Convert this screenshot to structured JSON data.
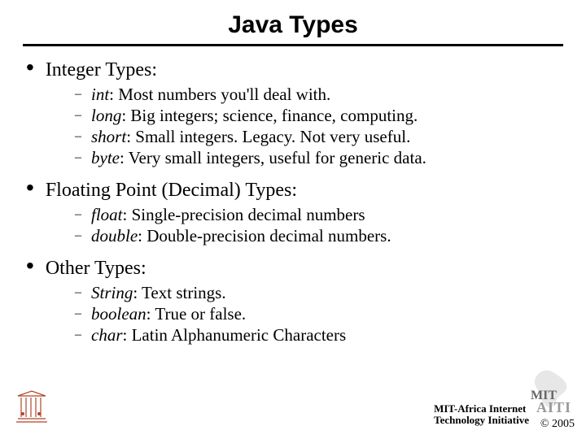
{
  "title": "Java Types",
  "sections": [
    {
      "label": "Integer Types:",
      "items": [
        {
          "keyword": "int",
          "desc": ": Most numbers you'll deal with."
        },
        {
          "keyword": "long",
          "desc": ": Big integers; science, finance, computing."
        },
        {
          "keyword": "short",
          "desc": ": Small integers. Legacy. Not very useful."
        },
        {
          "keyword": "byte",
          "desc": ": Very small integers, useful for generic data."
        }
      ]
    },
    {
      "label": "Floating Point (Decimal) Types:",
      "items": [
        {
          "keyword": "float",
          "desc": ": Single-precision decimal numbers"
        },
        {
          "keyword": "double",
          "desc": ": Double-precision decimal numbers."
        }
      ]
    },
    {
      "label": "Other Types:",
      "items": [
        {
          "keyword": "String",
          "desc": ": Text strings."
        },
        {
          "keyword": "boolean",
          "desc": ": True or false."
        },
        {
          "keyword": "char",
          "desc": ": Latin Alphanumeric Characters"
        }
      ]
    }
  ],
  "footer": {
    "org_line1": "MIT-Africa Internet",
    "org_line2": "Technology Initiative",
    "mit": "MIT",
    "aiti": "AITI",
    "copyright": "© 2005"
  }
}
